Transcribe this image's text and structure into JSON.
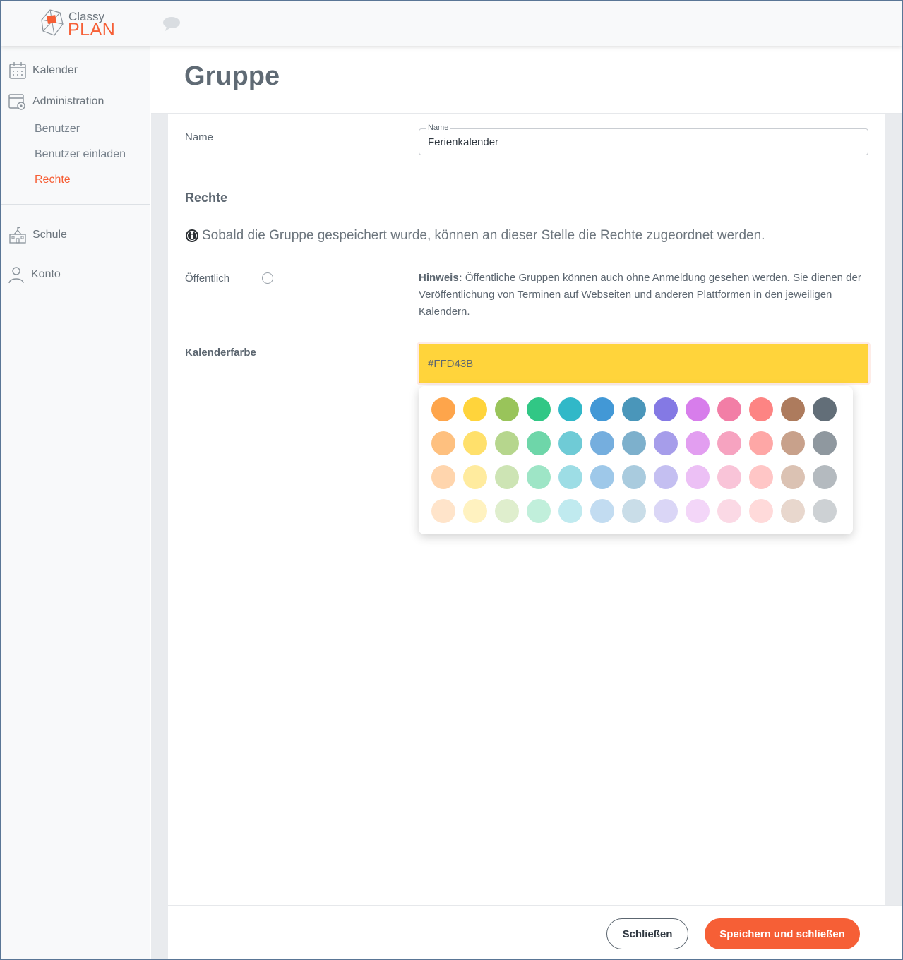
{
  "app": {
    "logo_top": "Classy",
    "logo_bottom": "PLAN",
    "brand_color": "#f65f36"
  },
  "sidebar": {
    "items": [
      {
        "label": "Kalender",
        "icon": "calendar-icon"
      },
      {
        "label": "Administration",
        "icon": "admin-calendar-gear-icon"
      },
      {
        "label": "Schule",
        "icon": "school-icon"
      },
      {
        "label": "Konto",
        "icon": "user-icon"
      }
    ],
    "sub_items": [
      {
        "label": "Benutzer",
        "active": false
      },
      {
        "label": "Benutzer einladen",
        "active": false
      },
      {
        "label": "Rechte",
        "active": true
      }
    ]
  },
  "page": {
    "title": "Gruppe"
  },
  "form": {
    "name_label": "Name",
    "name_field_legend": "Name",
    "name_value": "Ferienkalender",
    "rights_title": "Rechte",
    "rights_info": "Sobald die Gruppe gespeichert wurde, können an dieser Stelle die Rechte zugeordnet werden.",
    "public_label": "Öffentlich",
    "public_checked": false,
    "hint_prefix": "Hinweis:",
    "hint_text": " Öffentliche Gruppen können auch ohne Anmeldung gesehen werden. Sie dienen der Veröffentlichung von Terminen auf Webseiten und anderen Plattformen in den jeweiligen Kalendern.",
    "color_label": "Kalenderfarbe",
    "color_value": "#FFD43B"
  },
  "palette": [
    [
      "#fea54b",
      "#ffd43b",
      "#99c45a",
      "#31c785",
      "#31b8c8",
      "#4298d6",
      "#4a96ba",
      "#8479e4",
      "#d77deb",
      "#f27ea6",
      "#fd8483",
      "#ad7b5d",
      "#626e78"
    ],
    [
      "#fec07f",
      "#ffe06b",
      "#b6d68d",
      "#6ed6a9",
      "#6fcbd6",
      "#75aede",
      "#7db0cc",
      "#a69dea",
      "#e29ef0",
      "#f6a3c0",
      "#fea7a6",
      "#c8a18b",
      "#8f989f"
    ],
    [
      "#ffd5ad",
      "#ffeb9e",
      "#cde4b4",
      "#9ee5c6",
      "#9ddde5",
      "#9ec8e9",
      "#a9cbde",
      "#c4bff1",
      "#ecc0f5",
      "#f9c4d8",
      "#ffc6c6",
      "#dbc2b3",
      "#b4babf"
    ],
    [
      "#ffe4ca",
      "#fff2c0",
      "#dfeecd",
      "#c1efdb",
      "#c0eaef",
      "#c2dcf1",
      "#c9dde8",
      "#dad6f6",
      "#f3d6f8",
      "#fbd9e5",
      "#ffdada",
      "#e8d7cd",
      "#cdd1d4"
    ]
  ],
  "footer": {
    "close_label": "Schließen",
    "save_label": "Speichern und schließen"
  }
}
